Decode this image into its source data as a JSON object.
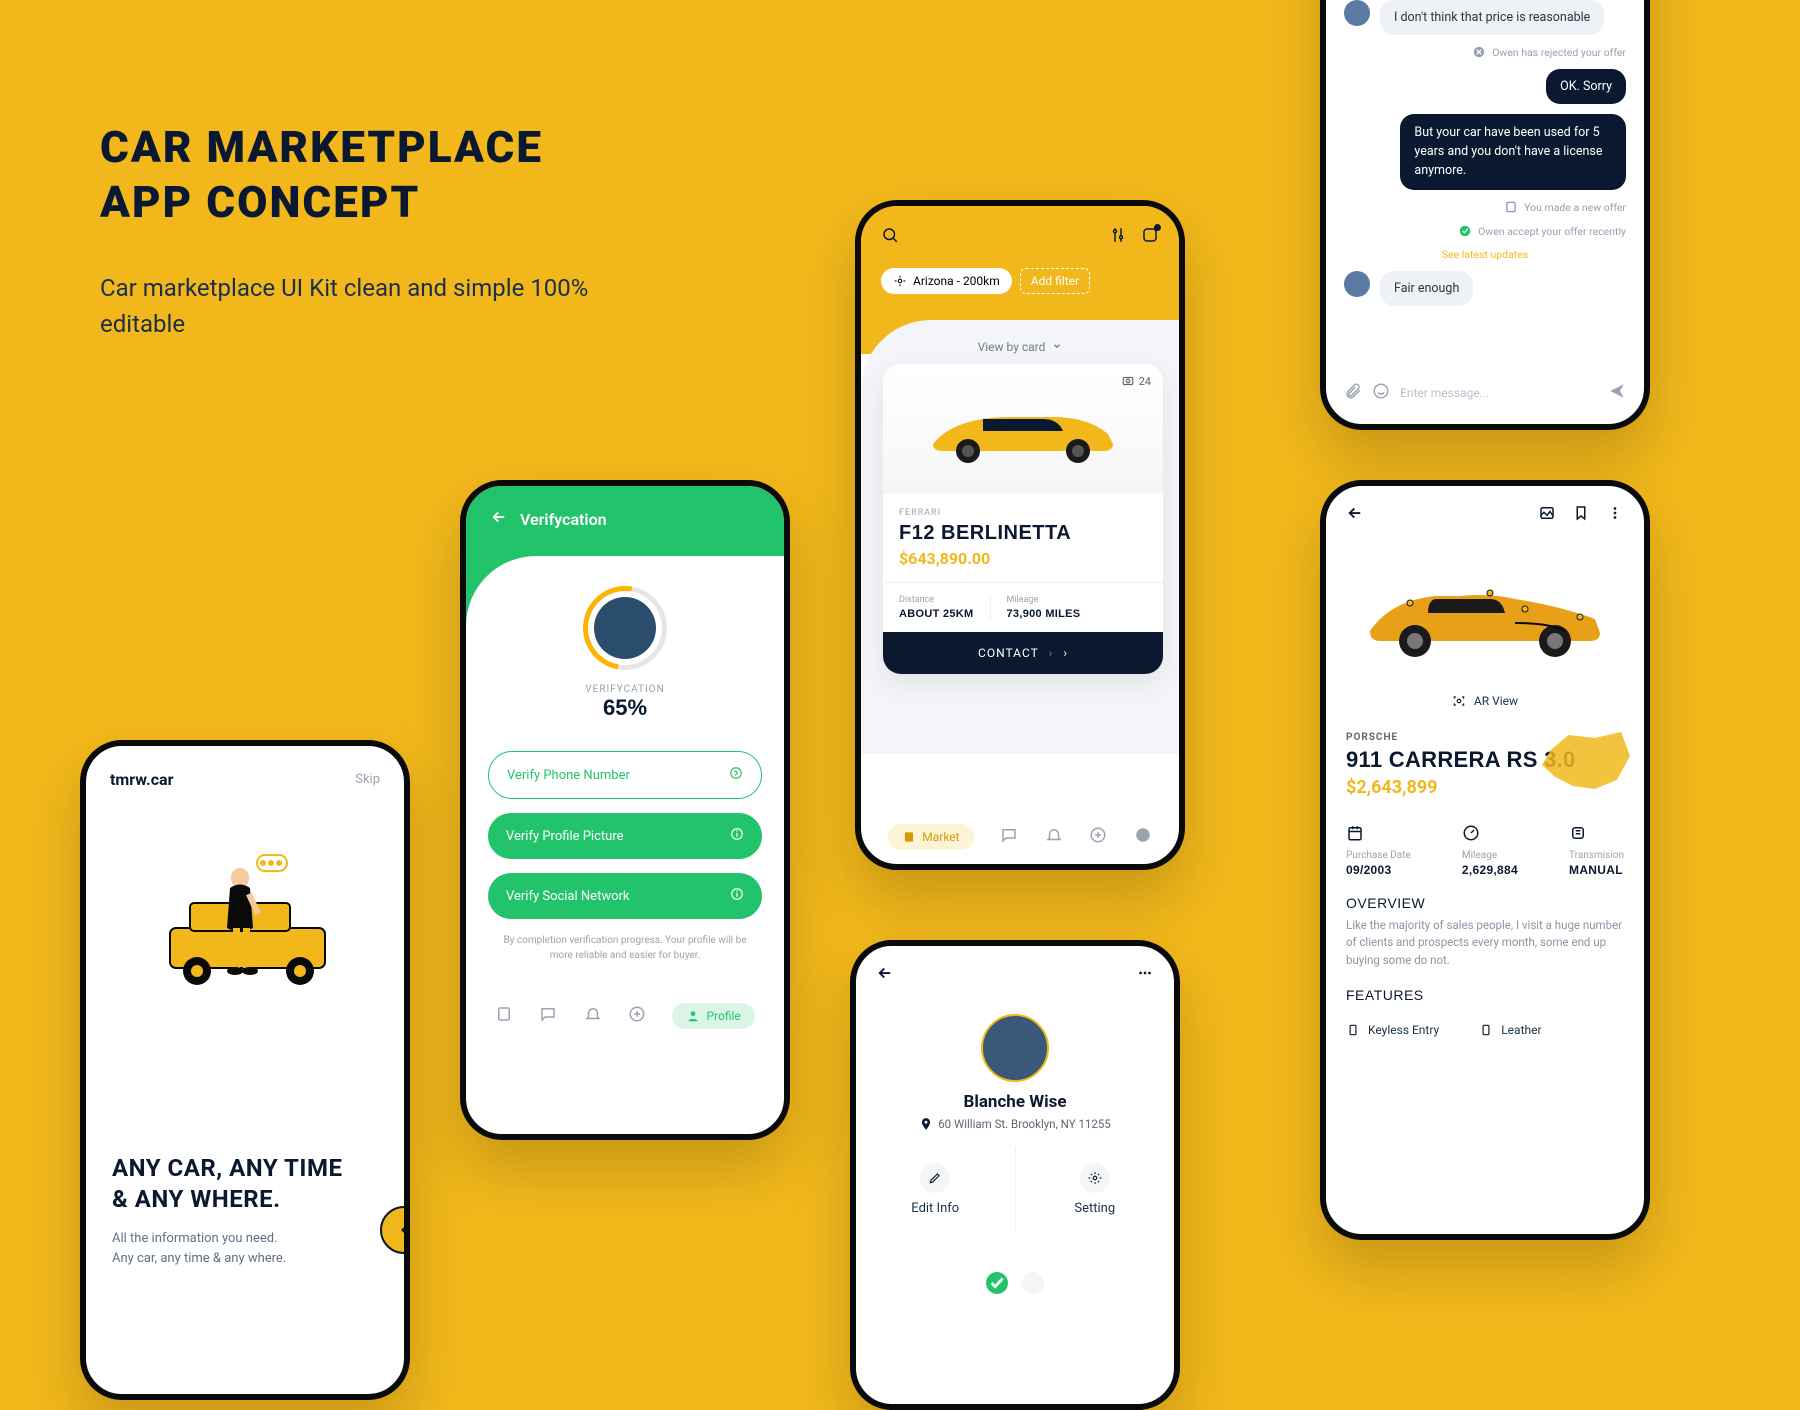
{
  "hero": {
    "title_l1": "CAR MARKETPLACE",
    "title_l2": "APP CONCEPT",
    "subtitle": "Car marketplace UI Kit clean and simple 100% editable"
  },
  "screen1": {
    "brand": "tmrw.car",
    "skip": "Skip",
    "headline_l1": "ANY CAR, ANY TIME",
    "headline_l2": "& ANY WHERE.",
    "sub_l1": "All the information you need.",
    "sub_l2": "Any car, any time & any where."
  },
  "screen2": {
    "title": "Verifycation",
    "label": "VERIFYCATION",
    "percent": "65%",
    "btn_phone": "Verify Phone Number",
    "btn_picture": "Verify Profile Picture",
    "btn_social": "Verify Social Network",
    "note": "By completion verification progress. Your profile will be more reliable and easier for buyer.",
    "tab_profile": "Profile"
  },
  "screen3": {
    "location": "Arizona - 200km",
    "add_filter": "Add filter",
    "view_by": "View by card",
    "card": {
      "count": "24",
      "brand": "FERRARI",
      "name": "F12 BERLINETTA",
      "price": "$643,890.00",
      "distance_label": "Distance",
      "distance": "ABOUT 25KM",
      "mileage_label": "Mileage",
      "mileage": "73,900 MILES",
      "contact": "CONTACT"
    },
    "tab_market": "Market"
  },
  "screen4": {
    "msg1": "I don't think that price is reasonable",
    "sys1": "Owen has rejected your offer",
    "msg2": "OK. Sorry",
    "msg3": "But your car have been used for 5 years and you don't  have a license anymore.",
    "sys2": "You made a new offer",
    "sys3": "Owen accept your offer recently",
    "link": "See latest updates",
    "msg4": "Fair enough",
    "placeholder": "Enter message..."
  },
  "screen5": {
    "ar": "AR View",
    "brand": "PORSCHE",
    "name": "911 CARRERA RS 3.0",
    "price": "$2,643,899",
    "spec1_label": "Purchase Date",
    "spec1": "09/2003",
    "spec2_label": "Mileage",
    "spec2": "2,629,884",
    "spec3_label": "Transmision",
    "spec3": "MANUAL",
    "overview_h": "OVERVIEW",
    "overview": "Like the majority of sales people, I visit a huge number of clients and prospects every month, some end up buying some do not.",
    "features_h": "FEATURES",
    "feat1": "Keyless Entry",
    "feat2": "Leather"
  },
  "screen6": {
    "name": "Blanche Wise",
    "address": "60 William St. Brooklyn, NY 11255",
    "edit": "Edit Info",
    "setting": "Setting"
  }
}
